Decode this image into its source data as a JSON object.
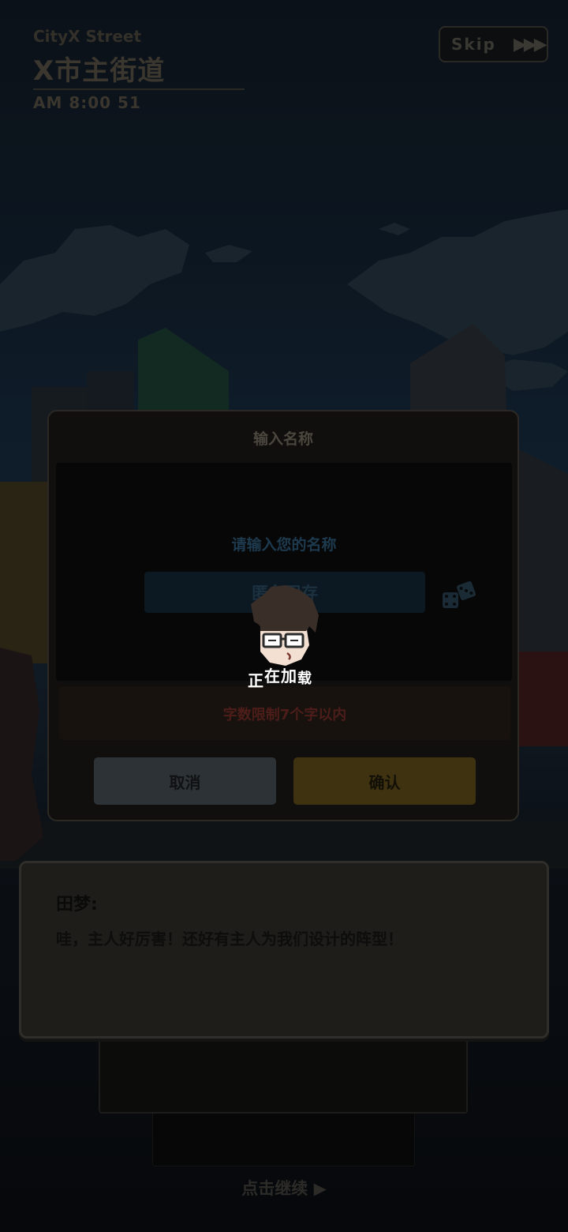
{
  "location": {
    "en": "CityX Street",
    "cn": "X市主街道",
    "time": "AM 8:00 51"
  },
  "skip": {
    "label": "Skip",
    "arrows": "▶▶▶"
  },
  "name_dialog": {
    "title": "输入名称",
    "prompt": "请输入您的名称",
    "input_value": "匿名用存",
    "dice_icon": "dice-icon",
    "limit_text": "字数限制7个字以内",
    "cancel_label": "取消",
    "confirm_label": "确认"
  },
  "loading": {
    "chars": [
      "正",
      "在",
      "加",
      "载"
    ],
    "mascot_icon": "mascot-face-icon"
  },
  "dialogue": {
    "speaker": "田梦:",
    "text": "哇，主人好厉害！还好有主人为我们设计的阵型！"
  },
  "continue_hint": "点击继续 ▶",
  "colors": {
    "confirm": "#3e3211",
    "cancel": "#2d3236",
    "limit_text": "#4d1d1a",
    "prompt": "#1e3a4e"
  }
}
